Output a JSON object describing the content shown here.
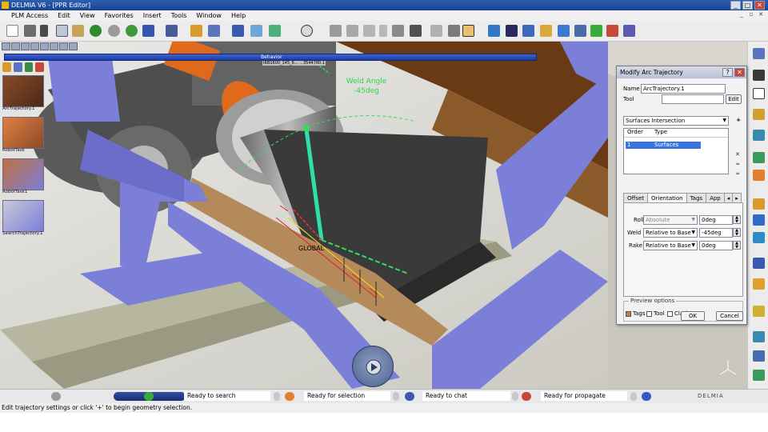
{
  "window": {
    "title": "DELMIA V6 - [PPR Editor]",
    "controls": [
      "_",
      "□",
      "✕"
    ]
  },
  "menu": {
    "items": [
      "PLM Access",
      "Edit",
      "View",
      "Favorites",
      "Insert",
      "Tools",
      "Window",
      "Help"
    ]
  },
  "behavior": {
    "label": "Behavior"
  },
  "tree": {
    "items": [
      {
        "label": "ArcTrajectory.1"
      },
      {
        "label": "RobotTask"
      },
      {
        "label": "RobotTask1"
      },
      {
        "label": "SearchTrajectory.1"
      }
    ]
  },
  "viewport": {
    "weld_angle_label": "Weld Angle",
    "weld_angle_value": "-45deg",
    "global_label": "GLOBAL",
    "tag_label": "IRB1600_145_6...",
    "tag_label_value": "...3544780.1"
  },
  "dialog": {
    "title": "Modify Arc Trajectory",
    "help_button": "?",
    "close_button": "✕",
    "name_label": "Name",
    "name_value": "ArcTrajectory.1",
    "tool_label": "Tool",
    "tool_value": "",
    "edit_button": "Edit",
    "method_value": "Surfaces Intersection",
    "add_button": "+",
    "list_headers": [
      "Order",
      "Type"
    ],
    "list_rows": [
      {
        "order": "1",
        "type": "Surfaces"
      }
    ],
    "tabs": [
      "Offset",
      "Orientation",
      "Tags",
      "App"
    ],
    "active_tab": "Orientation",
    "roll_label": "Roll",
    "roll_mode": "Absolute",
    "roll_value": "0deg",
    "weld_label": "Weld",
    "weld_mode": "Relative to Base",
    "weld_value": "-45deg",
    "rake_label": "Rake",
    "rake_mode": "Relative to Base",
    "rake_value": "0deg",
    "preview_title": "Preview options",
    "preview_tags": "Tags",
    "preview_tool": "Tool",
    "preview_clash": "Clash",
    "ok_button": "OK",
    "cancel_button": "Cancel"
  },
  "status": {
    "search": "Ready to search",
    "selection": "Ready for selection",
    "chat": "Ready to chat",
    "propagate": "Ready for propagate",
    "logo": "DELMIA"
  },
  "hint": "Edit trajectory settings or click '+' to begin geometry selection.",
  "colors": {
    "fixture_purple": "#7b7fd8",
    "robot_orange": "#e06a1c",
    "weld_green": "#2ee05a",
    "selection_blue": "#3a74e0"
  }
}
